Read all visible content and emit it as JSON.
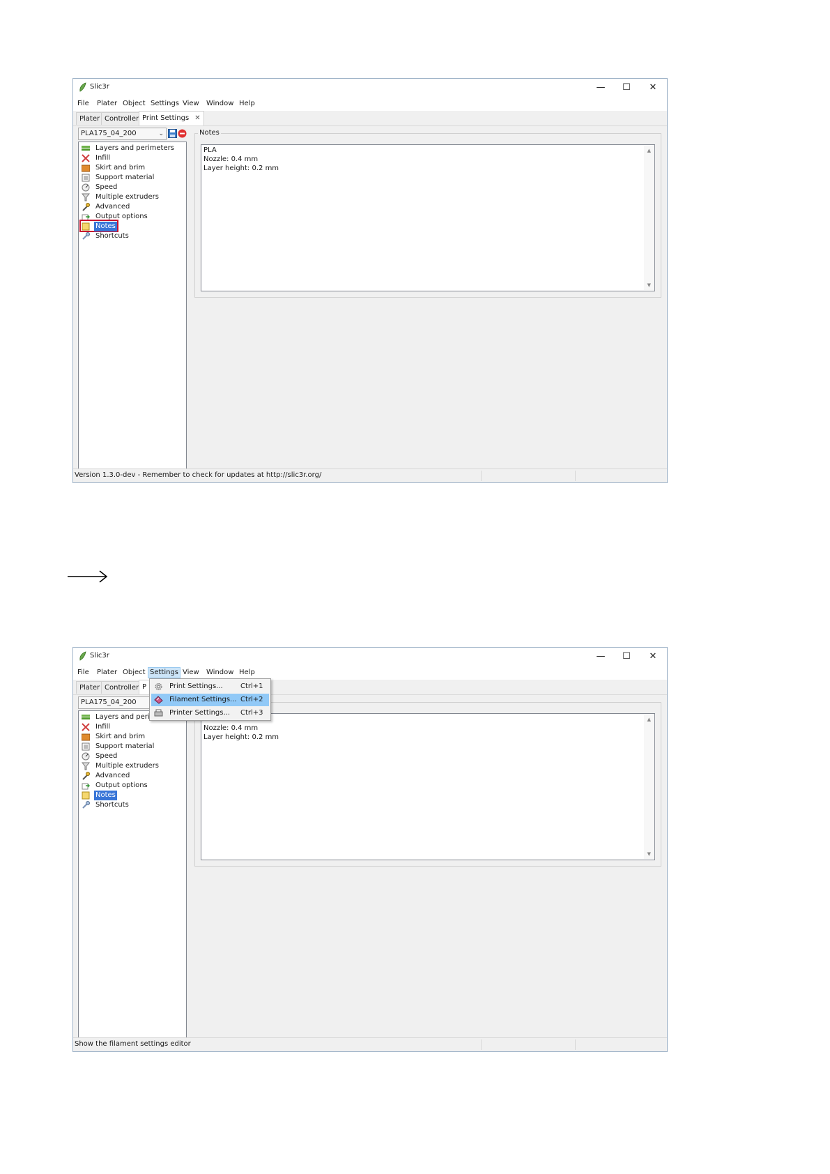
{
  "window1": {
    "app_title": "Slic3r",
    "window_controls": {
      "minimize": "—",
      "maximize": "☐",
      "close": "✕"
    },
    "menu": [
      "File",
      "Plater",
      "Object",
      "Settings",
      "View",
      "Window",
      "Help"
    ],
    "tabs": [
      "Plater",
      "Controller",
      "Print Settings"
    ],
    "tab_close": "✕",
    "preset": "PLA175_04_200",
    "tree_items": [
      {
        "label": "Layers and perimeters",
        "icon": "layers-icon"
      },
      {
        "label": "Infill",
        "icon": "infill-icon"
      },
      {
        "label": "Skirt and brim",
        "icon": "skirt-icon"
      },
      {
        "label": "Support material",
        "icon": "support-icon"
      },
      {
        "label": "Speed",
        "icon": "speed-icon"
      },
      {
        "label": "Multiple extruders",
        "icon": "funnel-icon"
      },
      {
        "label": "Advanced",
        "icon": "wrench-icon"
      },
      {
        "label": "Output options",
        "icon": "output-icon"
      },
      {
        "label": "Notes",
        "icon": "note-icon"
      },
      {
        "label": "Shortcuts",
        "icon": "shortcut-icon"
      }
    ],
    "selected_item": "Notes",
    "notes_group_label": "Notes",
    "notes_lines": [
      "PLA",
      "Nozzle: 0.4 mm",
      "Layer height: 0.2 mm"
    ],
    "status_text": "Version 1.3.0-dev - Remember to check for updates at http://slic3r.org/"
  },
  "arrow": {
    "icon": "arrow-right-icon"
  },
  "window2": {
    "app_title": "Slic3r",
    "window_controls": {
      "minimize": "—",
      "maximize": "☐",
      "close": "✕"
    },
    "menu": [
      "File",
      "Plater",
      "Object",
      "Settings",
      "View",
      "Window",
      "Help"
    ],
    "active_menu": "Settings",
    "tabs_visible": [
      "Plater",
      "Controller",
      "P"
    ],
    "preset": "PLA175_04_200",
    "tree_items": [
      {
        "label": "Layers and perim",
        "icon": "layers-icon"
      },
      {
        "label": "Infill",
        "icon": "infill-icon"
      },
      {
        "label": "Skirt and brim",
        "icon": "skirt-icon"
      },
      {
        "label": "Support material",
        "icon": "support-icon"
      },
      {
        "label": "Speed",
        "icon": "speed-icon"
      },
      {
        "label": "Multiple extruders",
        "icon": "funnel-icon"
      },
      {
        "label": "Advanced",
        "icon": "wrench-icon"
      },
      {
        "label": "Output options",
        "icon": "output-icon"
      },
      {
        "label": "Notes",
        "icon": "note-icon"
      },
      {
        "label": "Shortcuts",
        "icon": "shortcut-icon"
      }
    ],
    "selected_item": "Notes",
    "notes_lines_visible": [
      "Nozzle: 0.4 mm",
      "Layer height: 0.2 mm"
    ],
    "dropdown": [
      {
        "label": "Print Settings...",
        "shortcut": "Ctrl+1",
        "icon": "gear-icon"
      },
      {
        "label": "Filament Settings...",
        "shortcut": "Ctrl+2",
        "icon": "spool-icon",
        "hovered": true
      },
      {
        "label": "Printer Settings...",
        "shortcut": "Ctrl+3",
        "icon": "printer-icon"
      }
    ],
    "status_text": "Show the filament settings editor"
  }
}
